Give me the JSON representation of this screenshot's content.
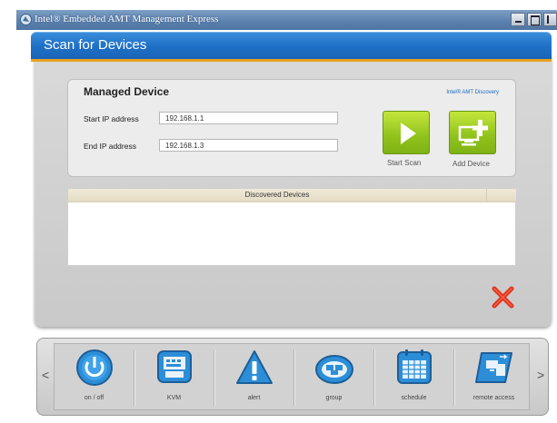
{
  "window": {
    "title": "Intel® Embedded AMT Management Express",
    "colors": {
      "titlebar": "#5a80ae",
      "header": "#1e70c6",
      "accent_stripe": "#e8a21e",
      "button_green": "#8fc21c",
      "close_red": "#e0321c"
    }
  },
  "header": {
    "title": "Scan for Devices"
  },
  "managed_device": {
    "title": "Managed Device",
    "discovery_link": "Intel® AMT Discovery",
    "start_ip_label": "Start IP address",
    "start_ip_value": "192.168.1.1",
    "end_ip_label": "End IP address",
    "end_ip_value": "192.168.1.3",
    "start_scan_label": "Start Scan",
    "add_device_label": "Add Device"
  },
  "discovered": {
    "header": "Discovered Devices",
    "rows": []
  },
  "dock": {
    "items": [
      {
        "label": "on / off",
        "icon": "power-icon"
      },
      {
        "label": "KVM",
        "icon": "kvm-icon"
      },
      {
        "label": "alert",
        "icon": "alert-icon"
      },
      {
        "label": "group",
        "icon": "group-icon"
      },
      {
        "label": "schedule",
        "icon": "schedule-icon"
      },
      {
        "label": "remote access",
        "icon": "remote-access-icon"
      }
    ],
    "prev_arrow": "<",
    "next_arrow": ">"
  }
}
